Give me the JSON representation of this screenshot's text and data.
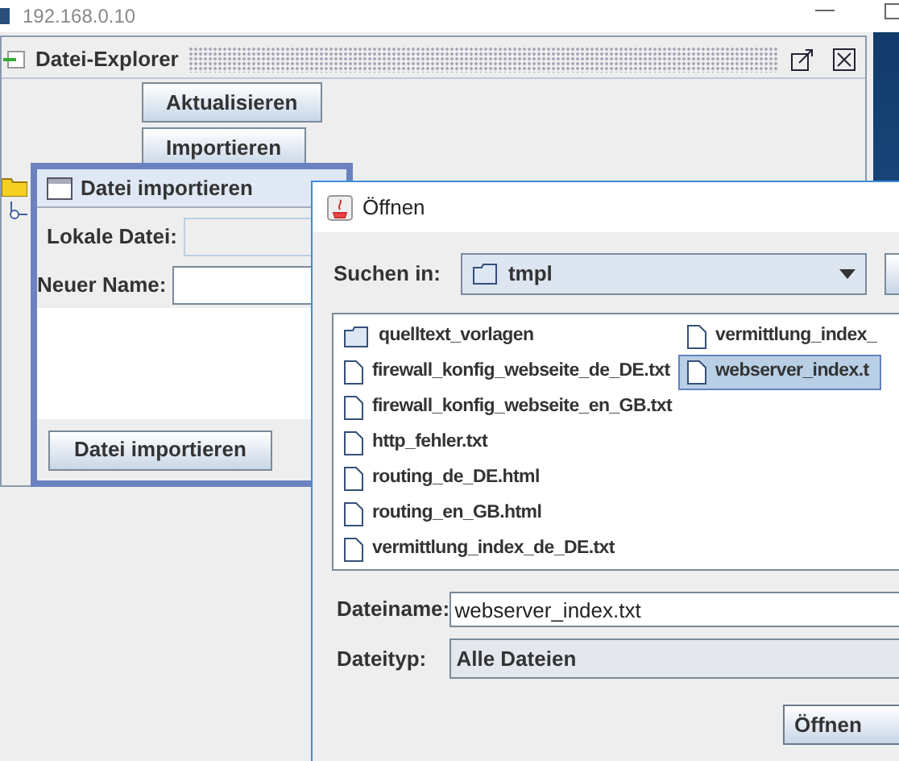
{
  "host_window": {
    "title": "192.168.0.10"
  },
  "explorer": {
    "title": "Datei-Explorer",
    "buttons": [
      "Aktualisieren",
      "Importieren"
    ]
  },
  "import_dialog": {
    "title": "Datei importieren",
    "fields": [
      {
        "label": "Lokale Datei:",
        "disabled": true
      },
      {
        "label": "Neuer Name:",
        "disabled": false
      }
    ],
    "button": "Datei importieren"
  },
  "open_dialog": {
    "title": "Öffnen",
    "look_in": {
      "label": "Suchen in:",
      "value": "tmpl"
    },
    "files": [
      {
        "name": "quelltext_vorlagen",
        "kind": "folder",
        "selected": false
      },
      {
        "name": "firewall_konfig_webseite_de_DE.txt",
        "kind": "file",
        "selected": false
      },
      {
        "name": "firewall_konfig_webseite_en_GB.txt",
        "kind": "file",
        "selected": false
      },
      {
        "name": "http_fehler.txt",
        "kind": "file",
        "selected": false
      },
      {
        "name": "routing_de_DE.html",
        "kind": "file",
        "selected": false
      },
      {
        "name": "routing_en_GB.html",
        "kind": "file",
        "selected": false
      },
      {
        "name": "vermittlung_index_de_DE.txt",
        "kind": "file",
        "selected": false
      },
      {
        "name": "vermittlung_index_",
        "kind": "file",
        "selected": false
      },
      {
        "name": "webserver_index.t",
        "kind": "file",
        "selected": true
      }
    ],
    "file_name": {
      "label": "Dateiname:",
      "value": "webserver_index.txt"
    },
    "file_type": {
      "label": "Dateityp:",
      "value": "Alle Dateien"
    },
    "open_button": "Öffnen"
  }
}
